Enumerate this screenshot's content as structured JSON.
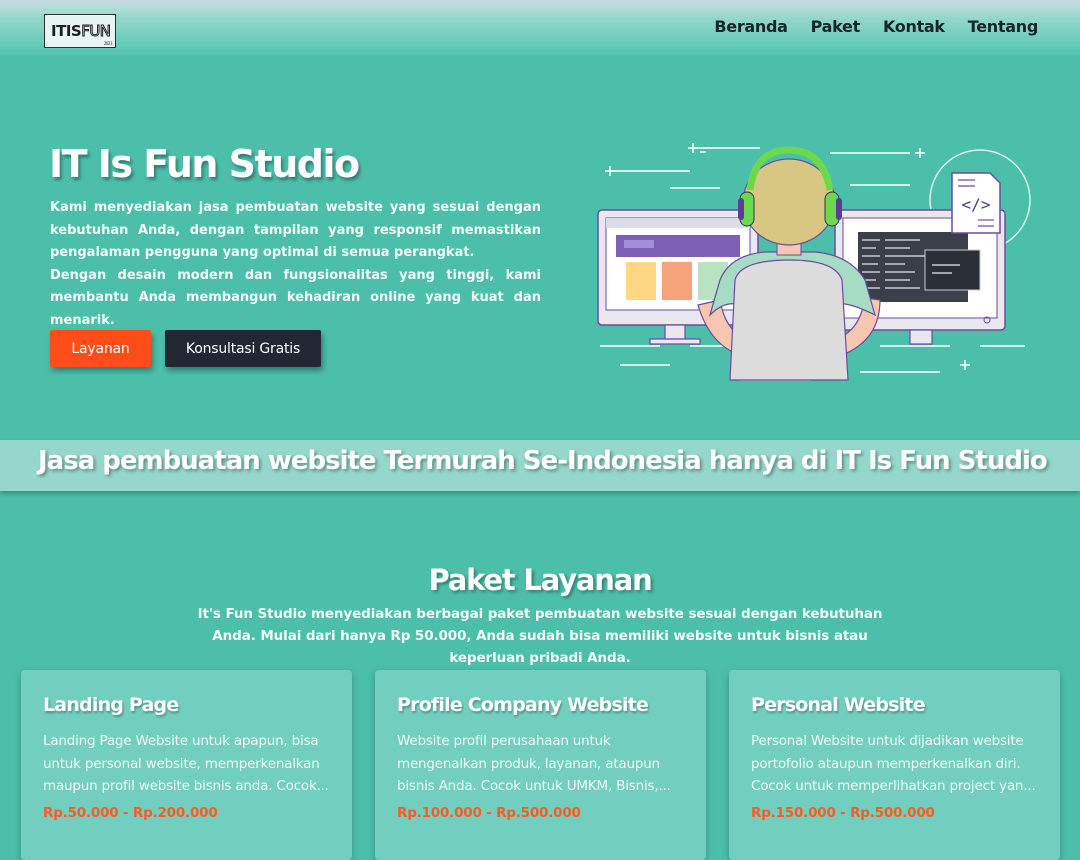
{
  "nav": {
    "logo_part1": "ITIS",
    "logo_part2": "FUN",
    "logo_year": "2023",
    "items": [
      {
        "label": "Beranda"
      },
      {
        "label": "Paket"
      },
      {
        "label": "Kontak"
      },
      {
        "label": "Tentang"
      }
    ]
  },
  "hero": {
    "title": "IT Is Fun Studio",
    "paragraph1": "Kami menyediakan jasa pembuatan website yang sesuai dengan kebutuhan Anda, dengan tampilan yang responsif memastikan pengalaman pengguna yang optimal di semua perangkat.",
    "paragraph2": "Dengan desain modern dan fungsionalitas yang tinggi, kami membantu Anda membangun kehadiran online yang kuat dan menarik.",
    "primary_button": "Layanan",
    "secondary_button": "Konsultasi Gratis",
    "code_symbol": "</>"
  },
  "banner": {
    "text": "Jasa pembuatan website Termurah Se-Indonesia hanya di IT Is Fun Studio"
  },
  "packages": {
    "title": "Paket Layanan",
    "description": "It's Fun Studio menyediakan berbagai paket pembuatan website sesuai dengan kebutuhan Anda. Mulai dari hanya Rp 50.000, Anda sudah bisa memiliki website untuk bisnis atau keperluan pribadi Anda.",
    "cards": [
      {
        "title": "Landing Page",
        "description": "Landing Page Website untuk apapun, bisa untuk personal website, memperkenalkan maupun profil website bisnis anda. Cocok...",
        "price": "Rp.50.000 - Rp.200.000"
      },
      {
        "title": "Profile Company Website",
        "description": "Website profil perusahaan untuk mengenalkan produk, layanan, ataupun bisnis Anda. Cocok untuk UMKM, Bisnis,...",
        "price": "Rp.100.000 - Rp.500.000"
      },
      {
        "title": "Personal Website",
        "description": "Personal Website untuk dijadikan website portofolio ataupun memperkenalkan diri. Cocok untuk memperlihatkan project yan...",
        "price": "Rp.150.000 - Rp.500.000"
      }
    ]
  },
  "colors": {
    "background": "#4cbfab",
    "accent": "#ff4d1a",
    "dark_button": "#232733",
    "card": "#72cfbf",
    "price": "#ff5a1f"
  }
}
